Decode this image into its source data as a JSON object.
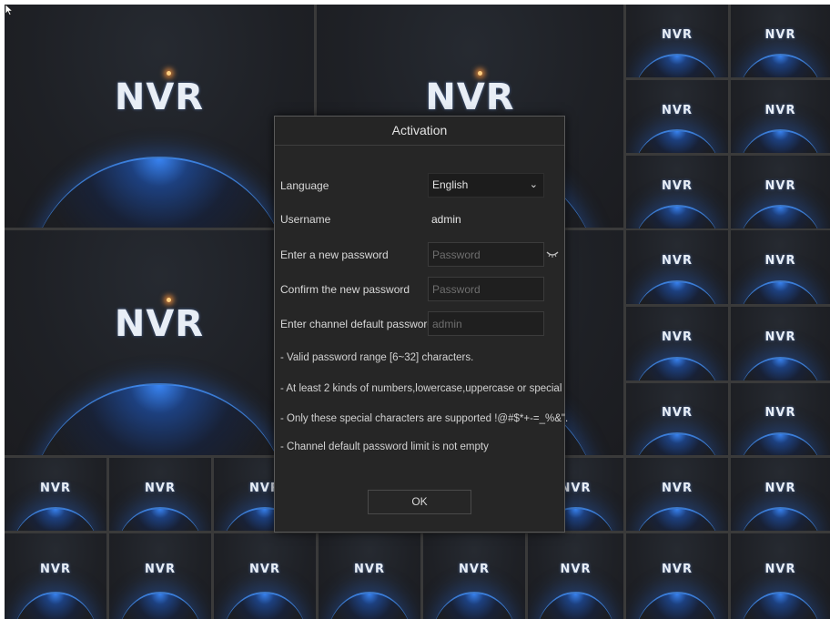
{
  "tile_logo": "NVR",
  "dialog": {
    "title": "Activation",
    "fields": {
      "language_label": "Language",
      "language_value": "English",
      "username_label": "Username",
      "username_value": "admin",
      "new_password_label": "Enter a new password",
      "new_password_placeholder": "Password",
      "confirm_password_label": "Confirm the new password",
      "confirm_password_placeholder": "Password",
      "channel_password_label": "Enter channel default password",
      "channel_password_placeholder": "admin"
    },
    "notes": [
      "- Valid password range [6~32] characters.",
      "- At least 2 kinds of numbers,lowercase,uppercase or special",
      "- Only these special characters are supported !@#$*+-=_%&\".",
      "- Channel default password limit is not empty"
    ],
    "ok_label": "OK"
  },
  "icons": {
    "dropdown": "chevron-down-icon",
    "password_visibility": "eye-closed-icon",
    "cursor": "mouse-pointer-icon"
  },
  "colors": {
    "glow_blue": "#3a8aff",
    "logo_accent": "#8db6ff",
    "dialog_bg": "#262626"
  }
}
